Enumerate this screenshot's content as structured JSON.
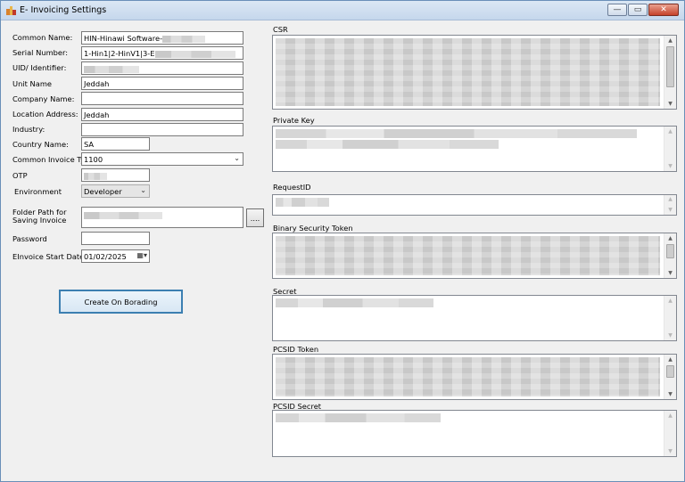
{
  "window": {
    "title": "E- Invoicing Settings",
    "minimize": "—",
    "maximize": "▭",
    "close": "✕"
  },
  "form": {
    "common_name_label": "Common Name:",
    "common_name_value": "HIN-Hinawi Software-",
    "serial_number_label": "Serial Number:",
    "serial_number_value": "1-Hin1|2-HinV1|3-E",
    "uid_label": "UID/ Identifier:",
    "unit_name_label": "Unit Name",
    "unit_name_value": "Jeddah",
    "company_name_label": "Company Name:",
    "company_name_value": "",
    "location_label": "Location Address:",
    "location_value": "Jeddah",
    "industry_label": "Industry:",
    "industry_value": "",
    "country_label": "Country Name:",
    "country_value": "SA",
    "invoice_type_label": "Common Invoice Type:",
    "invoice_type_value": "1100",
    "otp_label": "OTP",
    "environment_label": "Environment",
    "environment_value": "Developer",
    "folder_label_line1": "Folder Path for",
    "folder_label_line2": "Saving Invoice",
    "browse_label": "....",
    "password_label": "Password",
    "password_value": "",
    "start_date_label": "EInvoice Start Date:",
    "start_date_value": "01/02/2025",
    "create_button": "Create On Borading"
  },
  "fields": {
    "csr_label": "CSR",
    "private_key_label": "Private Key",
    "request_id_label": "RequestID",
    "binary_token_label": "Binary Security Token",
    "secret_label": "Secret",
    "pcsid_token_label": "PCSID Token",
    "pcsid_secret_label": "PCSID Secret"
  },
  "icons": {
    "app": "app-icon",
    "calendar": "calendar-icon",
    "dropdown": "chevron-down-icon"
  }
}
